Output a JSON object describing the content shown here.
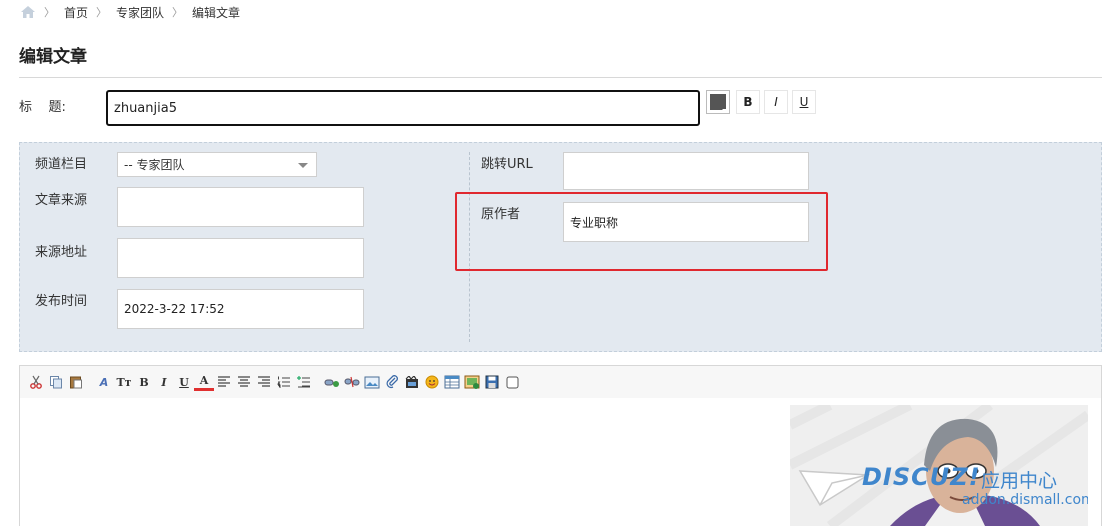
{
  "breadcrumb": {
    "items": [
      "首页",
      "专家团队",
      "编辑文章"
    ]
  },
  "page_title": "编辑文章",
  "title_row": {
    "label": "标    题:",
    "value": "zhuanjia5",
    "bold_label": "B",
    "italic_label": "I",
    "underline_label": "U"
  },
  "fields": {
    "channel": {
      "label": "频道栏目",
      "value": "-- 专家团队"
    },
    "source": {
      "label": "文章来源",
      "value": ""
    },
    "source_url": {
      "label": "来源地址",
      "value": ""
    },
    "publish_time": {
      "label": "发布时间",
      "value": "2022-3-22 17:52"
    },
    "redirect_url": {
      "label": "跳转URL",
      "value": ""
    },
    "author": {
      "label": "原作者",
      "value": "专业职称"
    }
  },
  "colors": {
    "highlight": "#e0282f",
    "panel_bg": "#e3e9f0",
    "watermark_blue": "#3f86cc"
  },
  "toolbar_icons": [
    "cut-icon",
    "copy-icon",
    "paste-icon",
    "font-family-icon",
    "font-size-icon",
    "bold-icon",
    "italic-icon",
    "underline-icon",
    "text-color-icon",
    "align-left-icon",
    "align-center-icon",
    "align-right-icon",
    "ordered-list-icon",
    "unordered-list-icon",
    "link-icon",
    "unlink-icon",
    "image-icon",
    "attachment-icon",
    "video-icon",
    "emoji-icon",
    "table-icon",
    "gallery-icon",
    "save-icon",
    "checkbox-icon"
  ],
  "toolbar_glyphs": {
    "font_family": "A",
    "font_size": "Tт",
    "bold": "B",
    "italic": "I",
    "underline": "U",
    "text_color": "A"
  },
  "watermark": {
    "brand": "DISCUZ!",
    "suffix": "应用中心",
    "url": "addon.dismall.com"
  }
}
